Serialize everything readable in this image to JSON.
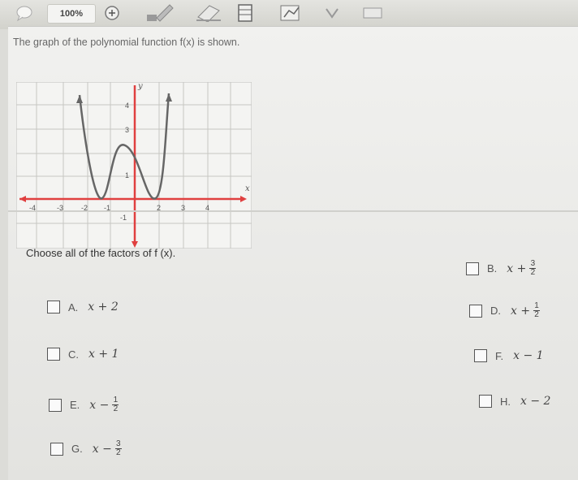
{
  "toolbar": {
    "zoom": "100%"
  },
  "question": {
    "prompt": "The graph of the polynomial function f(x) is shown.",
    "instruction": "Choose all of the factors of f (x)."
  },
  "graph": {
    "x_axis_label": "x",
    "y_axis_label": "y",
    "x_ticks": [
      "-4",
      "-3",
      "-2",
      "-1",
      "2",
      "3",
      "4"
    ],
    "y_ticks": [
      "4",
      "3",
      "1",
      "-1"
    ],
    "curve_color": "#666666",
    "axis_color": "#e04040"
  },
  "options": [
    {
      "letter": "A.",
      "expr": "x + 2"
    },
    {
      "letter": "B.",
      "expr": "x +",
      "num": "3",
      "den": "2"
    },
    {
      "letter": "C.",
      "expr": "x + 1"
    },
    {
      "letter": "D.",
      "expr": "x +",
      "num": "1",
      "den": "2"
    },
    {
      "letter": "E.",
      "expr": "x −",
      "num": "1",
      "den": "2"
    },
    {
      "letter": "F.",
      "expr": "x − 1"
    },
    {
      "letter": "G.",
      "expr": "x −",
      "num": "3",
      "den": "2"
    },
    {
      "letter": "H.",
      "expr": "x − 2"
    }
  ]
}
